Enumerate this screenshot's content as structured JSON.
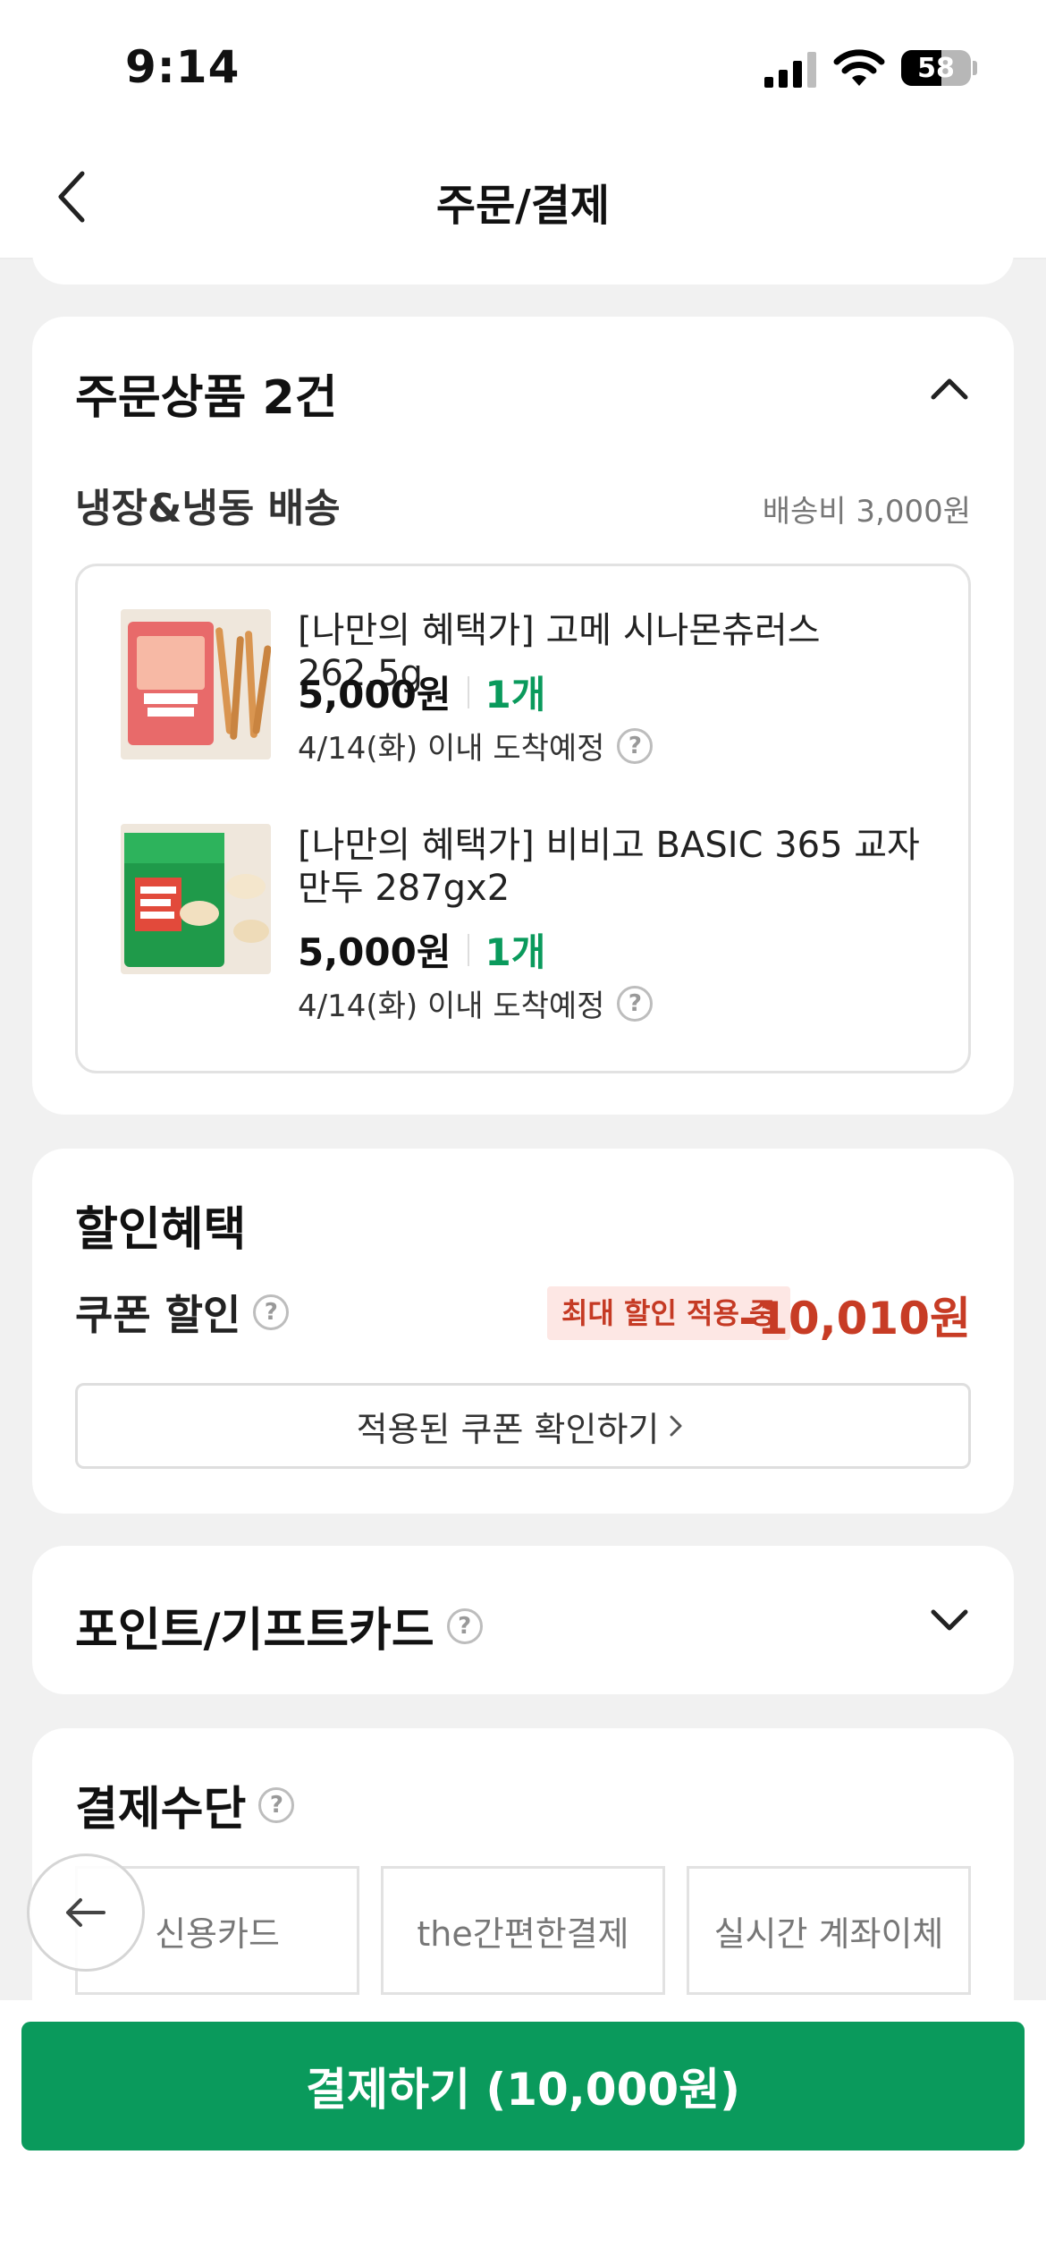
{
  "status_bar": {
    "time": "9:14",
    "battery": "58",
    "battery_level": 0.58
  },
  "nav": {
    "title": "주문/결제",
    "back_icon": "chevron-left-icon"
  },
  "order_items": {
    "title": "주문상품 2건",
    "toggle_icon": "chevron-up-icon",
    "shipping_type": "냉장&냉동 배송",
    "shipping_fee": "배송비 3,000원",
    "items": [
      {
        "name": "[나만의 혜택가] 고메 시나몬츄러스 262.5g",
        "price": "5,000원",
        "quantity": "1개",
        "eta": "4/14(화) 이내 도착예정"
      },
      {
        "name": "[나만의 혜택가] 비비고 BASIC 365 교자만두 287gx2",
        "price": "5,000원",
        "quantity": "1개",
        "eta": "4/14(화) 이내 도착예정"
      }
    ]
  },
  "discount": {
    "title": "할인혜택",
    "coupon_label": "쿠폰 할인",
    "max_badge": "최대 할인 적용 중",
    "amount": "-10,010원",
    "check_button": "적용된 쿠폰 확인하기",
    "accent_color": "#c73c25"
  },
  "points": {
    "title": "포인트/기프트카드",
    "toggle_icon": "chevron-down-icon"
  },
  "payment": {
    "title": "결제수단",
    "options": [
      "신용카드",
      "the간편한결제",
      "실시간 계좌이체"
    ]
  },
  "checkout": {
    "button": "결제하기 (10,000원)",
    "brand_color": "#0a9a5c"
  }
}
